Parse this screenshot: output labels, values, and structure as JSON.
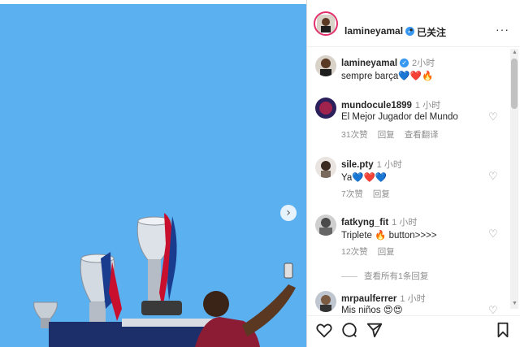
{
  "post": {
    "author": "lamineyamal",
    "follow_status": "已关注",
    "more": "···",
    "dot": "•"
  },
  "icons": {
    "verified": "verified-badge-icon",
    "next": "chevron-right-icon",
    "heart": "heart-icon",
    "comment": "comment-icon",
    "share": "share-icon",
    "save": "bookmark-icon"
  },
  "comments": [
    {
      "user": "lamineyamal",
      "time": "2小时",
      "text": "sempre barça💙❤️🔥",
      "meta": []
    },
    {
      "user": "mundocule1899",
      "time": "1 小时",
      "text": "El Mejor Jugador del Mundo",
      "meta": [
        "31次赞",
        "回复",
        "查看翻译"
      ]
    },
    {
      "user": "sile.pty",
      "time": "1 小时",
      "text": "Ya💙❤️💙",
      "meta": [
        "7次赞",
        "回复"
      ]
    },
    {
      "user": "fatkyng_fit",
      "time": "1 小时",
      "text": "Triplete 🔥 button>>>>",
      "meta": [
        "12次赞",
        "回复"
      ]
    },
    {
      "user": "mrpaulferrer",
      "time": "1 小时",
      "text": "Mis niños 😍😍",
      "meta": []
    }
  ],
  "view_replies": "查看所有1条回复",
  "colors": {
    "sky": "#5bb0f0",
    "verified": "#3897f0",
    "muted": "#8e8e8e"
  }
}
